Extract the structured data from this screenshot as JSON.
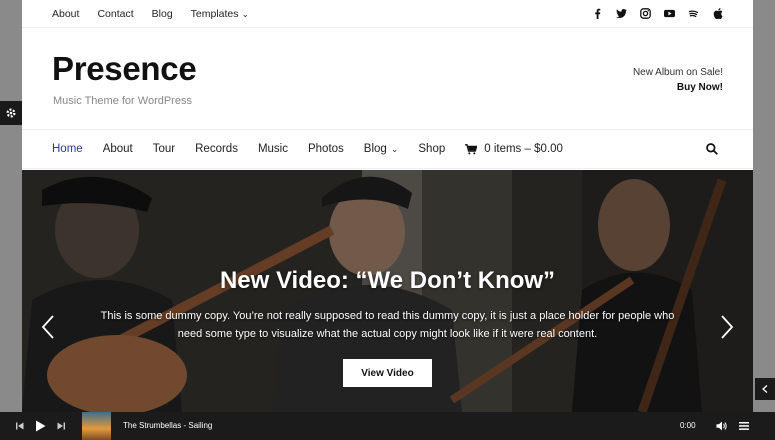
{
  "topbar": {
    "links": [
      {
        "label": "About"
      },
      {
        "label": "Contact"
      },
      {
        "label": "Blog"
      },
      {
        "label": "Templates"
      }
    ],
    "social_icons": [
      "facebook-icon",
      "twitter-icon",
      "instagram-icon",
      "youtube-icon",
      "spotify-icon",
      "apple-icon"
    ]
  },
  "header": {
    "title": "Presence",
    "tagline": "Music Theme for WordPress",
    "promo_line": "New Album on Sale!",
    "promo_cta": "Buy Now!"
  },
  "mainnav": {
    "items": [
      {
        "label": "Home"
      },
      {
        "label": "About"
      },
      {
        "label": "Tour"
      },
      {
        "label": "Records"
      },
      {
        "label": "Music"
      },
      {
        "label": "Photos"
      },
      {
        "label": "Blog"
      },
      {
        "label": "Shop"
      }
    ],
    "cart_label": "0 items – $0.00"
  },
  "hero": {
    "title": "New Video: “We Don’t Know”",
    "text": "This is some dummy copy. You’re not really supposed to read this dummy copy, it is just a place holder for people who need some type to visualize what the actual copy might look like if it were real content.",
    "button": "View Video"
  },
  "player": {
    "track": "The Strumbellas - Sailing",
    "time": "0:00"
  },
  "colors": {
    "accent": "#2c3a8f",
    "player_bg": "#1b1b1b",
    "page_bg": "#8a8a8a"
  }
}
